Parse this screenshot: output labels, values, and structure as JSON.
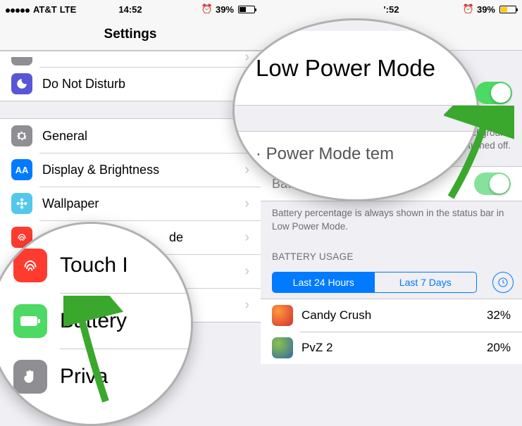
{
  "status": {
    "carrier": "AT&T",
    "network": "LTE",
    "time": "14:52",
    "battery_pct": "39%"
  },
  "nav": {
    "title": "Settings"
  },
  "left": {
    "control_center_half": "",
    "items": [
      {
        "icon": "moon-icon",
        "bg": "#5856d6",
        "label": "Do Not Disturb"
      },
      {
        "icon": "gear-icon",
        "bg": "#8e8e93",
        "label": "General"
      },
      {
        "icon": "aa-icon",
        "bg": "#007aff",
        "label": "Display & Brightness",
        "aa": "AA"
      },
      {
        "icon": "flower-icon",
        "bg": "#54c7ec",
        "label": "Wallpaper"
      },
      {
        "icon": "touchid-icon",
        "bg": "#ff3b30",
        "label": "Touch ID & Passcode",
        "short": "de"
      },
      {
        "icon": "battery-icon",
        "bg": "#4cd964",
        "label": "Battery"
      },
      {
        "icon": "hand-icon",
        "bg": "#8e8e93",
        "label": "Privacy"
      }
    ]
  },
  "mag1": {
    "row1": "Touch I",
    "row2": "Battery",
    "row3": "Priva"
  },
  "right": {
    "low_power": "Low Power Mode",
    "low_power_desc_partial": "ces  ·ower  ·harg·  your  ·tch, b·ckground  ·loads, and some  ·uced or turned off.",
    "power_mode_tem": "· Power Mode tem",
    "battery_pct_row": "Battery Percentage",
    "battery_pct_desc": "Battery percentage is always shown in the status bar in Low Power Mode.",
    "usage_header": "BATTERY USAGE",
    "seg": {
      "a": "Last 24 Hours",
      "b": "Last 7 Days"
    },
    "usage": [
      {
        "name": "Candy Crush",
        "pct": "32%"
      },
      {
        "name": "PvZ 2",
        "pct": "20%"
      }
    ]
  },
  "mag2": {
    "title": "Low Power Mode"
  },
  "status2": {
    "time_partial": "':52",
    "battery_pct": "39%"
  }
}
